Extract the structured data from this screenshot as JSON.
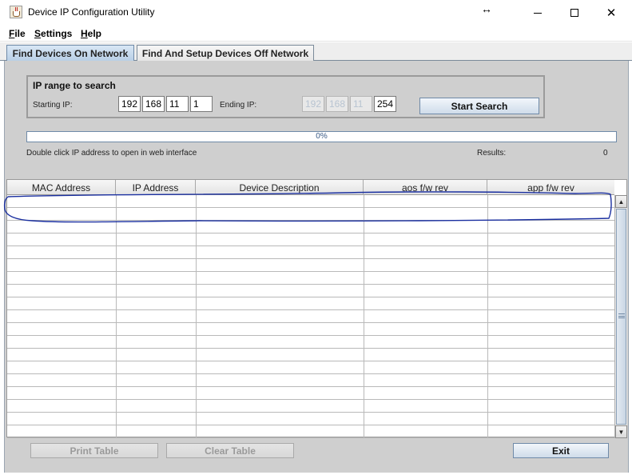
{
  "window": {
    "title": "Device IP Configuration Utility",
    "controls": {
      "minimize": "minimize",
      "maximize": "maximize",
      "close": "✕"
    },
    "resize_glyph": "↔"
  },
  "menu": {
    "items": [
      {
        "mnemonic": "F",
        "rest": "ile"
      },
      {
        "mnemonic": "S",
        "rest": "ettings"
      },
      {
        "mnemonic": "H",
        "rest": "elp"
      }
    ]
  },
  "tabs": [
    {
      "label": "Find Devices On Network",
      "active": true
    },
    {
      "label": "Find And Setup Devices Off Network",
      "active": false
    }
  ],
  "search": {
    "title": "IP range to search",
    "start_label": "Starting IP:",
    "end_label": "Ending IP:",
    "start_ip": [
      "192",
      "168",
      "11",
      "1"
    ],
    "end_ip": [
      "192",
      "168",
      "11",
      "254"
    ],
    "search_button": "Start Search"
  },
  "progress": {
    "percent": 0,
    "text": "0%"
  },
  "hint": "Double click IP address to open in web interface",
  "results": {
    "label": "Results:",
    "count": "0"
  },
  "table": {
    "columns": [
      "MAC Address",
      "IP Address",
      "Device Description",
      "aos f/w rev",
      "app f/w rev"
    ],
    "empty_rows": 19
  },
  "buttons": {
    "print": "Print Table",
    "clear": "Clear Table",
    "exit": "Exit"
  },
  "colors": {
    "accent": "#6f8aa8",
    "annotation": "#1a2fa0",
    "panel": "#cfcfcf"
  },
  "icons": {
    "app": "java-cup-icon",
    "scroll_up": "arrow-up-icon",
    "scroll_down": "arrow-down-icon"
  }
}
